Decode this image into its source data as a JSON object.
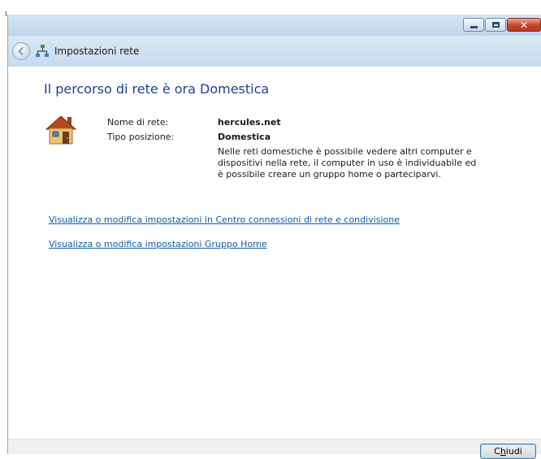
{
  "window": {
    "nav_title": "Impostazioni rete",
    "caption": {
      "close_glyph": "✕"
    }
  },
  "main": {
    "heading": "Il percorso di rete è ora Domestica",
    "network_name_label": "Nome di rete:",
    "network_name_value": "hercules.net",
    "location_type_label": "Tipo posizione:",
    "location_type_value": "Domestica",
    "description": "Nelle reti domestiche è possibile vedere altri computer e dispositivi nella rete, il computer in uso è individuabile ed è possibile creare un gruppo home o parteciparvi.",
    "link_network_center": "Visualizza o modifica impostazioni in Centro connessioni di rete e condivisione",
    "link_homegroup": "Visualizza o modifica impostazioni Gruppo Home"
  },
  "footer": {
    "close_label_prefix": "C",
    "close_label_underlined": "h",
    "close_label_suffix": "iudi"
  },
  "icons": {
    "back": "back-arrow-icon",
    "network": "network-icon",
    "home": "house-icon",
    "minimize": "minimize-icon",
    "maximize": "maximize-icon",
    "close": "close-icon"
  },
  "colors": {
    "heading": "#1e3f91",
    "link": "#0c5ba5",
    "window_frame": "#c7daee",
    "close_button_red": "#c7432a"
  }
}
